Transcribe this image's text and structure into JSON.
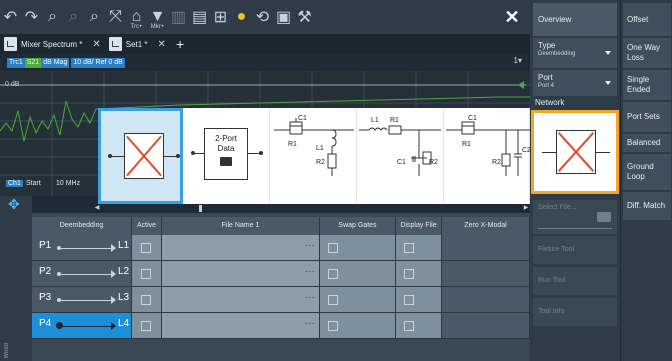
{
  "toolbar": {
    "icons": [
      "undo-icon",
      "redo-icon",
      "zoom-icon",
      "zoom-reset-icon",
      "zoom-fit-icon",
      "full-screen-icon",
      "trace-plus-icon",
      "marker-plus-icon",
      "delete-icon",
      "print-icon",
      "windows-icon",
      "help-icon",
      "refresh-icon",
      "screen-icon",
      "wrench-icon"
    ],
    "trc_label": "Trc+",
    "mkr_label": "Mkr+",
    "close": "✕"
  },
  "tabs": [
    {
      "label": "Mixer Spectrum *"
    },
    {
      "label": "Set1 *"
    }
  ],
  "tab_add": "+",
  "trace": {
    "ch": "Trc1",
    "param": "S21",
    "format": "dB Mag",
    "scale": "10 dB/ Ref 0 dB",
    "menu": "1▾"
  },
  "diagram": {
    "ref_label": "0 dB",
    "ch_label": "Ch1",
    "start_label": "Start",
    "start_value": "10 MHz"
  },
  "networks": {
    "data_card_line1": "2-Port",
    "data_card_line2": "Data"
  },
  "left_panel": {
    "vertical_text": "Wired"
  },
  "table": {
    "headers": [
      "Deembedding",
      "Active",
      "File Name 1",
      "Swap Gates",
      "Display File",
      "Zero X-Modal"
    ],
    "rows": [
      {
        "port": "P1",
        "label": "L1",
        "dots": "···"
      },
      {
        "port": "P2",
        "label": "L2",
        "dots": "···"
      },
      {
        "port": "P3",
        "label": "L3",
        "dots": "···"
      },
      {
        "port": "P4",
        "label": "L4",
        "dots": "···",
        "selected": true
      }
    ]
  },
  "right_panel": {
    "overview": "Overview",
    "type_label": "Type",
    "type_value": "Deembedding",
    "port_label": "Port",
    "port_value": "Port 4",
    "network_label": "Network",
    "select_file": "Select File...",
    "fixture_tool": "Fixture Tool",
    "run_tool": "Run Tool",
    "tool_info": "Tool Info"
  },
  "right_panel2": {
    "offset": "Offset",
    "one_way_loss": "One Way Loss",
    "single_ended": "Single Ended",
    "port_sets": "Port Sets",
    "balanced": "Balanced",
    "ground_loop": "Ground Loop",
    "diff_match": "Diff. Match"
  },
  "colors": {
    "accent": "#1d8fd8",
    "selection_orange": "#f5a623",
    "x_red": "#e24a2b",
    "trace_green": "#4ea83a"
  }
}
